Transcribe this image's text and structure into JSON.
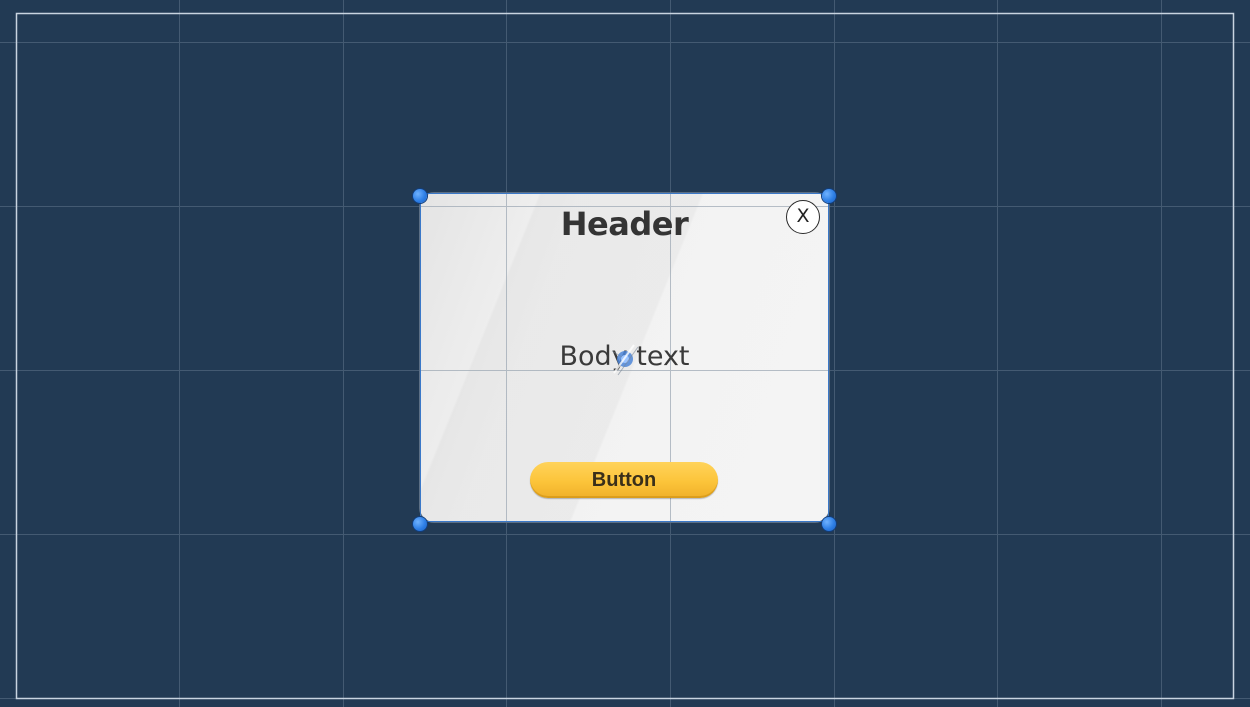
{
  "popup": {
    "header": "Header",
    "close_label": "X",
    "body_text": "Body text",
    "button_label": "Button"
  },
  "colors": {
    "canvas_background": "#223a54",
    "grid_line": "#4a6078",
    "frame_line": "#c8d4e0",
    "button_fill": "#fcc43a",
    "handle_fill": "#2e7fe6"
  },
  "icons": {
    "close": "close-icon",
    "pivot": "pivot-icon",
    "handle": "resize-handle-icon"
  }
}
